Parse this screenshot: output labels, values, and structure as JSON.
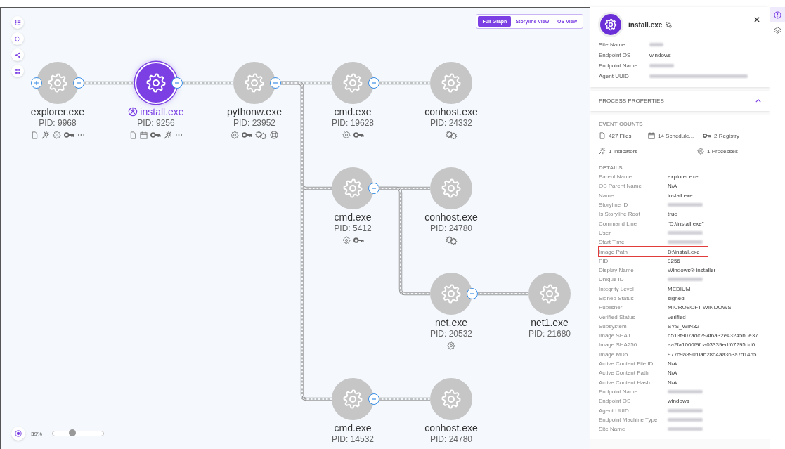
{
  "toolbar": {
    "buttons": [
      {
        "kind": "list"
      },
      {
        "kind": "exit"
      },
      {
        "kind": "share"
      },
      {
        "kind": "fit"
      }
    ]
  },
  "view_switch": [
    {
      "label": "Full Graph",
      "selected": true
    },
    {
      "label": "Storyline View",
      "selected": false
    },
    {
      "label": "OS View",
      "selected": false
    }
  ],
  "graph": {
    "root": {
      "name": "explorer.exe",
      "pid": "PID: 9968",
      "selected": false,
      "parent_collapsed": true,
      "events": [
        {
          "kind": "files"
        },
        {
          "kind": "indicators"
        },
        {
          "kind": "processes"
        },
        {
          "kind": "registry"
        },
        {
          "kind": "more"
        }
      ],
      "children": [
        {
          "name": "install.exe",
          "pid": "PID: 9256",
          "selected": true,
          "storyline_root": true,
          "events": [
            {
              "kind": "files"
            },
            {
              "kind": "scheduled"
            },
            {
              "kind": "registry"
            },
            {
              "kind": "indicators"
            },
            {
              "kind": "more"
            }
          ],
          "children": [
            {
              "name": "pythonw.exe",
              "pid": "PID: 23952",
              "selected": false,
              "events": [
                {
                  "kind": "processes"
                },
                {
                  "kind": "registry"
                },
                {
                  "kind": "modules"
                },
                {
                  "kind": "network"
                }
              ],
              "children": [
                {
                  "name": "cmd.exe",
                  "pid": "PID: 19628",
                  "selected": false,
                  "events": [
                    {
                      "kind": "processes"
                    },
                    {
                      "kind": "registry"
                    }
                  ],
                  "children": [
                    {
                      "name": "conhost.exe",
                      "pid": "PID: 24332",
                      "selected": false,
                      "events": [
                        {
                          "kind": "modules"
                        }
                      ]
                    }
                  ]
                },
                {
                  "name": "cmd.exe",
                  "pid": "PID: 5412",
                  "selected": false,
                  "events": [
                    {
                      "kind": "processes"
                    },
                    {
                      "kind": "registry"
                    }
                  ],
                  "children": [
                    {
                      "name": "conhost.exe",
                      "pid": "PID: 24780",
                      "selected": false,
                      "events": [
                        {
                          "kind": "modules"
                        }
                      ]
                    },
                    {
                      "name": "net.exe",
                      "pid": "PID: 20532",
                      "selected": false,
                      "events": [
                        {
                          "kind": "processes"
                        }
                      ],
                      "children": [
                        {
                          "name": "net1.exe",
                          "pid": "PID: 21680",
                          "selected": false
                        }
                      ]
                    }
                  ]
                },
                {
                  "name": "cmd.exe",
                  "pid": "PID: 14532",
                  "selected": false,
                  "children": [
                    {
                      "name": "conhost.exe",
                      "pid": "PID: 24780",
                      "selected": false
                    }
                  ]
                }
              ]
            }
          ]
        }
      ]
    }
  },
  "zoom": {
    "label": "39%",
    "level": 0.39
  },
  "panel": {
    "title": "install.exe",
    "info": [
      {
        "label": "Site Name",
        "redacted": true
      },
      {
        "label": "Endpoint OS",
        "value": "windows"
      },
      {
        "label": "Endpoint Name",
        "redacted": true
      },
      {
        "label": "Agent UUID",
        "redacted": true
      }
    ],
    "section": {
      "title": "PROCESS PROPERTIES",
      "expanded": true
    },
    "event_counts_title": "EVENT COUNTS",
    "event_counts": [
      {
        "kind": "files",
        "text": "427 Files"
      },
      {
        "kind": "scheduled",
        "text": "14 Schedule..."
      },
      {
        "kind": "registry",
        "text": "2 Registry"
      },
      {
        "kind": "indicators",
        "text": "1 Indicators"
      },
      {
        "kind": "processes",
        "text": "1 Processes"
      }
    ],
    "details_title": "DETAILS",
    "details": [
      {
        "label": "Parent Name",
        "value": "explorer.exe"
      },
      {
        "label": "OS Parent Name",
        "value": "N/A"
      },
      {
        "label": "Name",
        "value": "install.exe"
      },
      {
        "label": "Storyline ID",
        "redacted": true
      },
      {
        "label": "Is Storyline Root",
        "value": "true"
      },
      {
        "label": "Command Line",
        "value": "\"D:\\install.exe\""
      },
      {
        "label": "User",
        "redacted": true
      },
      {
        "label": "Start Time",
        "redacted": true
      },
      {
        "label": "Image Path",
        "value": "D:\\install.exe",
        "highlighted": true
      },
      {
        "label": "PID",
        "value": "9256"
      },
      {
        "label": "Display Name",
        "value": "Windows® installer"
      },
      {
        "label": "Unique ID",
        "redacted": true
      },
      {
        "label": "Integrity Level",
        "value": "MEDIUM"
      },
      {
        "label": "Signed Status",
        "value": "signed"
      },
      {
        "label": "Publisher",
        "value": "MICROSOFT WINDOWS"
      },
      {
        "label": "Verified Status",
        "value": "verified"
      },
      {
        "label": "Subsystem",
        "value": "SYS_WIN32"
      },
      {
        "label": "Image SHA1",
        "value": "6513f907adc294f6a32e43245b0e37..."
      },
      {
        "label": "Image SHA256",
        "value": "aa2fa1000f9fca03339edf67295dd0..."
      },
      {
        "label": "Image MD5",
        "value": "977c9a890f0ab2864aa363a7d1455..."
      },
      {
        "label": "Active Content File ID",
        "value": "N/A"
      },
      {
        "label": "Active Content Path",
        "value": "N/A"
      },
      {
        "label": "Active Content Hash",
        "value": "N/A"
      },
      {
        "label": "Endpoint Name",
        "redacted": true
      },
      {
        "label": "Endpoint OS",
        "value": "windows"
      },
      {
        "label": "Agent UUID",
        "redacted": true
      },
      {
        "label": "Endpoint Machine Type",
        "redacted": true
      },
      {
        "label": "Site Name",
        "redacted": true
      }
    ]
  },
  "side_tabs": [
    {
      "kind": "info",
      "selected": true
    },
    {
      "kind": "layers",
      "selected": false
    }
  ]
}
